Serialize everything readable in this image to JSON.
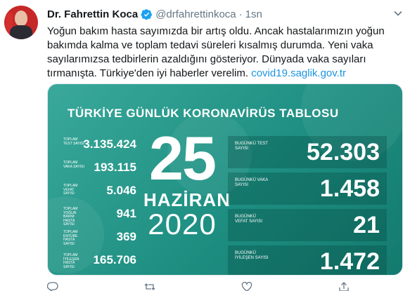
{
  "tweet": {
    "author_name": "Dr. Fahrettin Koca",
    "handle": "@drfahrettinkoca",
    "separator": "·",
    "time": "1sn",
    "text_lines": [
      "Yoğun bakım hasta sayımızda bir artış oldu. Ancak hastalarımızın yoğun",
      "bakımda kalma ve toplam tedavi süreleri kısalmış durumda. Yeni vaka",
      "sayılarımızsa tedbirlerin azaldığını gösteriyor. Dünyada vaka sayıları",
      "tırmanışta. Türkiye'den iyi haberler verelim. "
    ],
    "link": "covid19.saglik.gov.tr"
  },
  "card": {
    "title": "TÜRKİYE GÜNLÜK KORONAVİRÜS TABLOSU",
    "date": {
      "day": "25",
      "month": "HAZİRAN",
      "year": "2020"
    },
    "totals": [
      {
        "label": "TOPLAM TEST SAYISI",
        "value": "3.135.424"
      },
      {
        "label": "TOPLAM VAKA SAYISI",
        "value": "193.115"
      },
      {
        "label": "TOPLAM VEFAT SAYISI",
        "value": "5.046"
      },
      {
        "label": "TOPLAM YOĞUN BAKIM HASTA SAYISI",
        "value": "941"
      },
      {
        "label": "TOPLAM ENTÜBE HASTA SAYISI",
        "value": "369"
      },
      {
        "label": "TOPLAM İYİLEŞEN HASTA SAYISI",
        "value": "165.706"
      }
    ],
    "today": [
      {
        "label": "BUGÜNKÜ TEST SAYISI",
        "value": "52.303"
      },
      {
        "label": "BUGÜNKÜ VAKA SAYISI",
        "value": "1.458"
      },
      {
        "label": "BUGÜNKÜ VEFAT SAYISI",
        "value": "21"
      },
      {
        "label": "BUGÜNKÜ İYİLEŞEN SAYISI",
        "value": "1.472"
      }
    ]
  },
  "colors": {
    "card_background": "#1e8f82",
    "link": "#1b95e0",
    "verified": "#1da1f2",
    "muted": "#657786"
  },
  "icons": [
    "verified-badge-icon",
    "chevron-down-icon",
    "reply-icon",
    "retweet-icon",
    "like-icon",
    "share-icon"
  ]
}
